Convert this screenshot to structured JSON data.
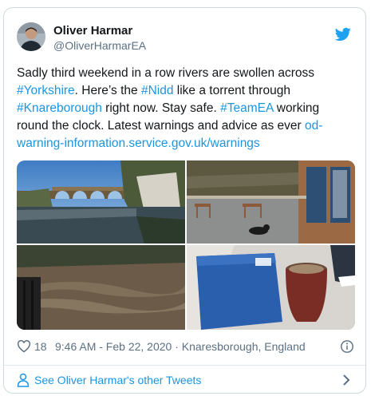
{
  "tweet": {
    "author_name": "Oliver Harmar",
    "author_handle": "@OliverHarmarEA",
    "text": [
      {
        "t": "Sadly third weekend in a row rivers are swollen across ",
        "link": false
      },
      {
        "t": "#Yorkshire",
        "link": true
      },
      {
        "t": ".  Here’s the ",
        "link": false
      },
      {
        "t": "#Nidd",
        "link": true
      },
      {
        "t": " like a torrent through ",
        "link": false
      },
      {
        "t": "#Knareborough",
        "link": true
      },
      {
        "t": " right now. Stay safe. ",
        "link": false
      },
      {
        "t": "#TeamEA",
        "link": true
      },
      {
        "t": " working round the clock. Latest warnings and advice as ever ",
        "link": false
      },
      {
        "t": "od-warning-information.service.gov.uk/warnings",
        "link": true
      }
    ],
    "likes": "18",
    "meta": "9:46 AM - Feb 22, 2020 · Knaresborough, England",
    "more_label": "See Oliver Harmar's other Tweets"
  },
  "colors": {
    "link": "#1b95e0",
    "muted": "#5b7083",
    "border": "#cfd9de",
    "twitter_blue": "#1da1f2"
  },
  "icons": {
    "brand": "twitter-bird-icon",
    "like": "heart-icon",
    "info": "info-icon",
    "profile": "person-icon",
    "chevron": "chevron-right-icon"
  },
  "media": [
    "viaduct-river-photo",
    "flooded-riverside-cafe-photo",
    "swollen-river-photo",
    "flood-board-and-plant-pot-photo"
  ]
}
